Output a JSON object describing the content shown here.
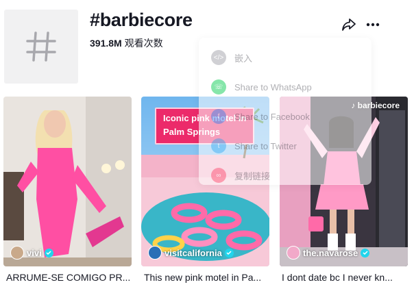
{
  "header": {
    "title": "#barbiecore",
    "views_count": "391.8M",
    "views_label": "观看次数"
  },
  "icons": {
    "hashtag": "hashtag-icon",
    "share": "share-arrow-icon",
    "more": "more-horizontal-icon"
  },
  "share_menu": {
    "items": [
      {
        "label": "嵌入",
        "icon": "embed-icon",
        "color": "#bfbfc4"
      },
      {
        "label": "Share to WhatsApp",
        "icon": "whatsapp-icon",
        "color": "#25d366"
      },
      {
        "label": "Share to Facebook",
        "icon": "facebook-icon",
        "color": "#1877f2"
      },
      {
        "label": "Share to Twitter",
        "icon": "twitter-icon",
        "color": "#1da1f2"
      },
      {
        "label": "复制链接",
        "icon": "link-icon",
        "color": "#fe2c55"
      }
    ]
  },
  "videos": [
    {
      "author": "vivi",
      "caption": "ARRUME-SE COMIGO PR...",
      "verified": true
    },
    {
      "author": "visitcalifornia",
      "caption": "This new pink motel in Pa...",
      "verified": true,
      "overlay_text": [
        "Iconic pink motel in",
        "Palm Springs"
      ]
    },
    {
      "author": "the.navarose",
      "caption": "I dont date bc I never kn...",
      "verified": true,
      "overlay_badge": "barbiecore"
    }
  ],
  "colors": {
    "accent": "#fe2c55",
    "verified": "#20d5ec"
  }
}
